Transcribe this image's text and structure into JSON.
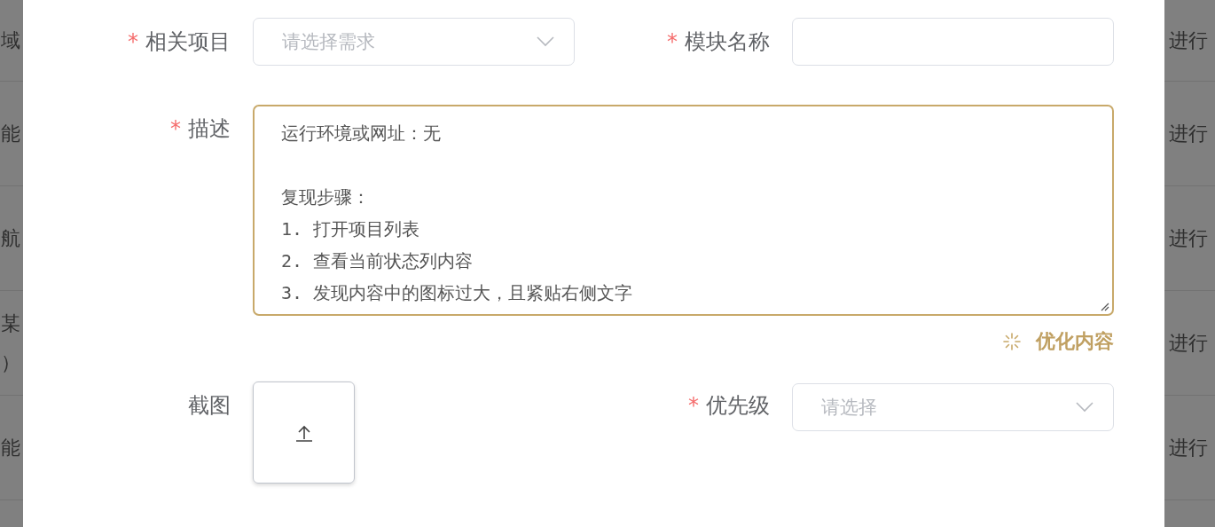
{
  "background_table": {
    "column_1": [
      [
        "域"
      ],
      [
        "能"
      ],
      [
        "航"
      ],
      [
        "某",
        "）"
      ],
      [
        "能"
      ]
    ],
    "column_2": [
      "进行",
      "进行",
      "进行",
      "进行",
      "进行"
    ]
  },
  "dialog": {
    "rows": [
      {
        "fields": [
          {
            "kind": "select",
            "required_mark": "*",
            "label": "相关项目",
            "placeholder": "请选择需求"
          },
          {
            "kind": "input",
            "required_mark": "*",
            "label": "模块名称"
          }
        ]
      },
      {
        "fields": [
          {
            "kind": "textarea",
            "required_mark": "*",
            "label": "描述",
            "paragraphs": [
              [
                "运行环境或网址：无"
              ],
              [
                "复现步骤：",
                "1. 打开项目列表",
                "2. 查看当前状态列内容",
                "3. 发现内容中的图标过大，且紧贴右侧文字"
              ]
            ],
            "action": "优化内容"
          }
        ]
      },
      {
        "fields": [
          {
            "kind": "upload",
            "label": "截图"
          },
          {
            "kind": "select",
            "required_mark": "*",
            "label": "优先级",
            "placeholder": "请选择"
          }
        ]
      }
    ]
  }
}
